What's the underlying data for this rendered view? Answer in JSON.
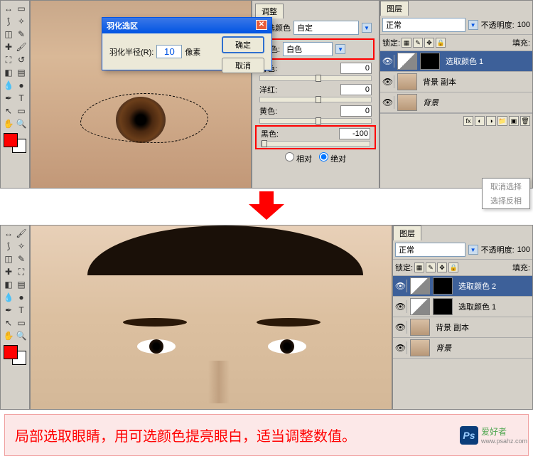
{
  "dialog": {
    "title": "羽化选区",
    "radius_label": "羽化半径(R):",
    "radius_value": "10",
    "unit": "像素",
    "ok": "确定",
    "cancel": "取消"
  },
  "adjust": {
    "tab": "调整",
    "method_label": "可选颜色",
    "method_value": "自定",
    "color_label": "颜色:",
    "color_value": "白色",
    "cyan": {
      "label": "青色:",
      "value": "0"
    },
    "magenta": {
      "label": "洋红:",
      "value": "0"
    },
    "yellow": {
      "label": "黄色:",
      "value": "0"
    },
    "black": {
      "label": "黑色:",
      "value": "-100"
    },
    "relative": "相对",
    "absolute": "绝对"
  },
  "layers_top": {
    "tab": "图层",
    "blend": "正常",
    "opacity_label": "不透明度:",
    "opacity_value": "100",
    "lock_label": "锁定:",
    "fill_label": "填充:",
    "items": [
      {
        "name": "选取颜色 1",
        "type": "adj",
        "selected": true
      },
      {
        "name": "背景 副本",
        "type": "img"
      },
      {
        "name": "背景",
        "type": "img",
        "italic": true
      }
    ]
  },
  "layers_bottom": {
    "tab": "图层",
    "blend": "正常",
    "opacity_label": "不透明度:",
    "opacity_value": "100",
    "lock_label": "锁定:",
    "fill_label": "填充:",
    "items": [
      {
        "name": "选取颜色 2",
        "type": "adj",
        "selected": true
      },
      {
        "name": "选取颜色 1",
        "type": "adj"
      },
      {
        "name": "背景 副本",
        "type": "img"
      },
      {
        "name": "背景",
        "type": "img",
        "italic": true
      }
    ]
  },
  "context": {
    "deselect": "取消选择",
    "select_inverse": "选择反相"
  },
  "caption": "局部选取眼睛，用可选颜色提亮眼白，适当调整数值。",
  "watermark": {
    "text": "爱好者",
    "url": "www.psahz.com",
    "logo": "Ps"
  }
}
